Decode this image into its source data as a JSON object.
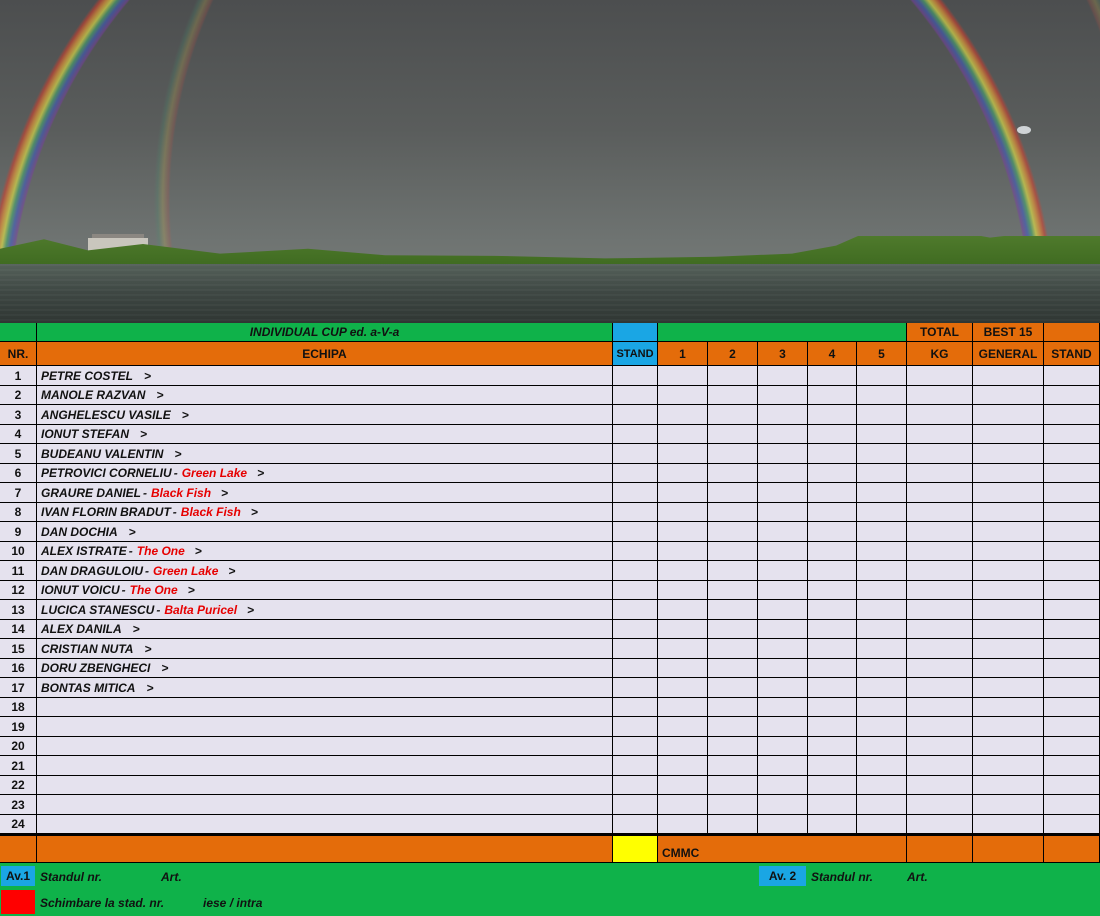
{
  "sheet": {
    "title": "INDIVIDUAL CUP ed. a-V-a",
    "headers": {
      "nr": "NR.",
      "echipa": "ECHIPA",
      "stand": "STAND",
      "m1": "1",
      "m2": "2",
      "m3": "3",
      "m4": "4",
      "m5": "5",
      "total_top": "TOTAL",
      "total_bottom": "KG",
      "best_top": "BEST 15",
      "best_bottom": "GENERAL",
      "stand_final": "STAND"
    },
    "rows": [
      {
        "nr": "1",
        "name": "PETRE COSTEL",
        "sep": "",
        "team": "",
        "arrow": ">"
      },
      {
        "nr": "2",
        "name": "MANOLE RAZVAN",
        "sep": "",
        "team": "",
        "arrow": ">"
      },
      {
        "nr": "3",
        "name": "ANGHELESCU VASILE",
        "sep": "",
        "team": "",
        "arrow": ">"
      },
      {
        "nr": "4",
        "name": "IONUT STEFAN",
        "sep": "",
        "team": "",
        "arrow": ">"
      },
      {
        "nr": "5",
        "name": "BUDEANU VALENTIN",
        "sep": "",
        "team": "",
        "arrow": ">"
      },
      {
        "nr": "6",
        "name": "PETROVICI CORNELIU",
        "sep": "-",
        "team": "Green Lake",
        "arrow": ">"
      },
      {
        "nr": "7",
        "name": "GRAURE DANIEL",
        "sep": "-",
        "team": "Black Fish",
        "arrow": ">"
      },
      {
        "nr": "8",
        "name": "IVAN FLORIN BRADUT",
        "sep": "-",
        "team": "Black Fish",
        "arrow": ">"
      },
      {
        "nr": "9",
        "name": "DAN DOCHIA",
        "sep": "",
        "team": "",
        "arrow": ">"
      },
      {
        "nr": "10",
        "name": "ALEX ISTRATE",
        "sep": "-",
        "team": "The One",
        "arrow": ">"
      },
      {
        "nr": "11",
        "name": "DAN DRAGULOIU",
        "sep": "-",
        "team": "Green Lake",
        "arrow": ">"
      },
      {
        "nr": "12",
        "name": "IONUT VOICU",
        "sep": "-",
        "team": "The One",
        "arrow": ">"
      },
      {
        "nr": "13",
        "name": "LUCICA STANESCU",
        "sep": "-",
        "team": "Balta Puricel",
        "arrow": ">"
      },
      {
        "nr": "14",
        "name": "ALEX DANILA",
        "sep": "",
        "team": "",
        "arrow": ">"
      },
      {
        "nr": "15",
        "name": "CRISTIAN NUTA",
        "sep": "",
        "team": "",
        "arrow": ">"
      },
      {
        "nr": "16",
        "name": "DORU ZBENGHECI",
        "sep": "",
        "team": "",
        "arrow": ">"
      },
      {
        "nr": "17",
        "name": "BONTAS MITICA",
        "sep": "",
        "team": "",
        "arrow": ">"
      },
      {
        "nr": "18",
        "name": "",
        "sep": "",
        "team": "",
        "arrow": ""
      },
      {
        "nr": "19",
        "name": "",
        "sep": "",
        "team": "",
        "arrow": ""
      },
      {
        "nr": "20",
        "name": "",
        "sep": "",
        "team": "",
        "arrow": ""
      },
      {
        "nr": "21",
        "name": "",
        "sep": "",
        "team": "",
        "arrow": ""
      },
      {
        "nr": "22",
        "name": "",
        "sep": "",
        "team": "",
        "arrow": ""
      },
      {
        "nr": "23",
        "name": "",
        "sep": "",
        "team": "",
        "arrow": ""
      },
      {
        "nr": "24",
        "name": "",
        "sep": "",
        "team": "",
        "arrow": ""
      }
    ],
    "footer": {
      "cmmc": "CMMC"
    },
    "legend": {
      "av1": "Av.1",
      "av1_standul": "Standul nr.",
      "av1_art": "Art.",
      "av2": "Av. 2",
      "av2_standul": "Standul  nr.",
      "av2_art": "Art.",
      "schimbare": "Schimbare la stad.  nr.",
      "iese": "iese / intra"
    }
  },
  "colors": {
    "header_green": "#0fb24a",
    "header_orange": "#e46c0a",
    "stand_blue": "#1aa6e4",
    "row_lavender": "#e5e2ee",
    "team_red": "#e60000",
    "cmmc_yellow": "#ffff00",
    "legend_red": "#ff0000"
  }
}
